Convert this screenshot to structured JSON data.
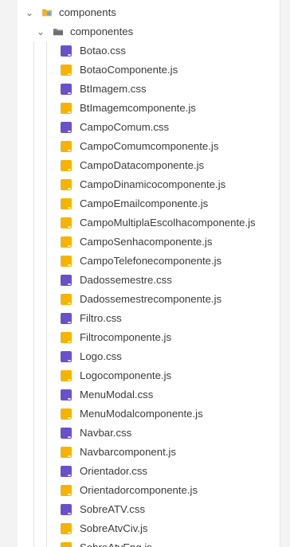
{
  "tree": {
    "root": {
      "label": "components",
      "expanded": true
    },
    "child": {
      "label": "componentes",
      "expanded": true
    },
    "files": [
      {
        "name": "Botao.css",
        "type": "css"
      },
      {
        "name": "BotaoComponente.js",
        "type": "js"
      },
      {
        "name": "BtImagem.css",
        "type": "css"
      },
      {
        "name": "BtImagemcomponente.js",
        "type": "js"
      },
      {
        "name": "CampoComum.css",
        "type": "css"
      },
      {
        "name": "CampoComumcomponente.js",
        "type": "js"
      },
      {
        "name": "CampoDatacomponente.js",
        "type": "js"
      },
      {
        "name": "CampoDinamicocomponente.js",
        "type": "js"
      },
      {
        "name": "CampoEmailcomponente.js",
        "type": "js"
      },
      {
        "name": "CampoMultiplaEscolhacomponente.js",
        "type": "js"
      },
      {
        "name": "CampoSenhacomponente.js",
        "type": "js"
      },
      {
        "name": "CampoTelefonecomponente.js",
        "type": "js"
      },
      {
        "name": "Dadossemestre.css",
        "type": "css"
      },
      {
        "name": "Dadossemestrecomponente.js",
        "type": "js"
      },
      {
        "name": "Filtro.css",
        "type": "css"
      },
      {
        "name": "Filtrocomponente.js",
        "type": "js"
      },
      {
        "name": "Logo.css",
        "type": "css"
      },
      {
        "name": "Logocomponente.js",
        "type": "js"
      },
      {
        "name": "MenuModal.css",
        "type": "css"
      },
      {
        "name": "MenuModalcomponente.js",
        "type": "js"
      },
      {
        "name": "Navbar.css",
        "type": "css"
      },
      {
        "name": "Navbarcomponent.js",
        "type": "js"
      },
      {
        "name": "Orientador.css",
        "type": "css"
      },
      {
        "name": "Orientadorcomponente.js",
        "type": "js"
      },
      {
        "name": "SobreATV.css",
        "type": "css"
      },
      {
        "name": "SobreAtvCiv.js",
        "type": "js"
      },
      {
        "name": "SobreAtvEng.js",
        "type": "js"
      }
    ]
  },
  "colors": {
    "css_icon": "#6a51c9",
    "js_icon": "#f4b400",
    "root_folder_icon": "#f2b233",
    "child_folder_icon": "#6d6d6d"
  }
}
